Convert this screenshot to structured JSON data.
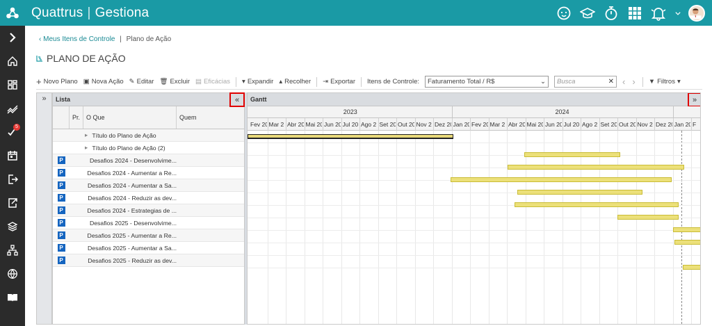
{
  "app": {
    "brand": "Quattrus",
    "separator": "|",
    "product": "Gestiona"
  },
  "sidebar": {
    "items": [
      {
        "icon": "chevron-right-icon"
      },
      {
        "icon": "home-icon"
      },
      {
        "icon": "dashboard-icon"
      },
      {
        "icon": "trend-icon"
      },
      {
        "icon": "checklist-icon",
        "badge": "5"
      },
      {
        "icon": "calendar-icon"
      },
      {
        "icon": "export-icon"
      },
      {
        "icon": "export-alt-icon"
      },
      {
        "icon": "layers-icon"
      },
      {
        "icon": "sitemap-icon"
      },
      {
        "icon": "globe-icon"
      },
      {
        "icon": "book-icon"
      }
    ]
  },
  "topbar": {
    "icons": [
      "baby-face-icon",
      "graduation-cap-icon",
      "stopwatch-icon",
      "apps-grid-icon",
      "bell-icon"
    ]
  },
  "breadcrumb": {
    "back": "Meus Itens de Controle",
    "sep": "|",
    "current": "Plano de Ação"
  },
  "page": {
    "title": "PLANO DE AÇÃO"
  },
  "toolbar": {
    "novo_plano": "Novo Plano",
    "nova_acao": "Nova Ação",
    "editar": "Editar",
    "excluir": "Excluir",
    "eficacias": "Eficácias",
    "expandir": "Expandir",
    "recolher": "Recolher",
    "exportar": "Exportar",
    "itens_label": "Itens de Controle:",
    "itens_value": "Faturamento Total / R$",
    "busca_placeholder": "Busca",
    "filtros": "Filtros"
  },
  "lista": {
    "header": "Lista",
    "collapse": "«",
    "columns": [
      "Pr.",
      "O Que",
      "Quem"
    ],
    "rows": [
      {
        "type": "group",
        "what": "Título do Plano de Ação"
      },
      {
        "type": "group",
        "what": "Título do Plano de Ação (2)"
      },
      {
        "type": "item",
        "badge": "P",
        "what": "Desafios 2024 - Desenvolvime..."
      },
      {
        "type": "item",
        "badge": "P",
        "what": "Desafios 2024 - Aumentar a Re..."
      },
      {
        "type": "item",
        "badge": "P",
        "what": "Desafios 2024 - Aumentar a Sa..."
      },
      {
        "type": "item",
        "badge": "P",
        "what": "Desafios 2024 - Reduzir as dev..."
      },
      {
        "type": "item",
        "badge": "P",
        "what": "Desafios 2024 - Estrategias de ..."
      },
      {
        "type": "item",
        "badge": "P",
        "what": "Desafios 2025 - Desenvolvime..."
      },
      {
        "type": "item",
        "badge": "P",
        "what": "Desafios 2025 - Aumentar a Re..."
      },
      {
        "type": "item",
        "badge": "P",
        "what": "Desafios 2025 - Aumentar a Sa..."
      },
      {
        "type": "item",
        "badge": "P",
        "what": "Desafios 2025 - Reduzir as dev..."
      }
    ]
  },
  "strip": {
    "expand": "»"
  },
  "gantt": {
    "header": "Gantt",
    "expand": "»",
    "years": [
      "2023",
      "2024"
    ],
    "months": [
      "Fev 20",
      "Mar 2",
      "Abr 20",
      "Mai 20",
      "Jun 20",
      "Jul 20",
      "Ago 2",
      "Set 20",
      "Out 20",
      "Nov 2",
      "Dez 20",
      "Jan 20",
      "Fev 20",
      "Mar 2",
      "Abr 20",
      "Mai 20",
      "Jun 20",
      "Jul 20",
      "Ago 2",
      "Set 20",
      "Out 20",
      "Nov 2",
      "Dez 20",
      "Jan 20",
      "F"
    ]
  },
  "colors": {
    "brand": "#1a9aa5",
    "sidebar": "#2b2b2b",
    "bar": "#ece07a",
    "highlight": "#e00000"
  }
}
